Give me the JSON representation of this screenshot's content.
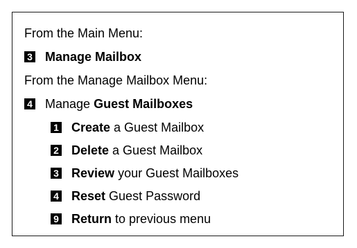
{
  "main_menu": {
    "intro": "From the Main Menu:",
    "key": "3",
    "label": "Manage Mailbox"
  },
  "mailbox_menu": {
    "intro": "From the Manage Mailbox Menu:",
    "key": "4",
    "label_plain": "Manage ",
    "label_bold": "Guest Mailboxes"
  },
  "guest_options": [
    {
      "key": "1",
      "action": "Create",
      "rest": " a Guest Mailbox"
    },
    {
      "key": "2",
      "action": "Delete",
      "rest": " a Guest Mailbox"
    },
    {
      "key": "3",
      "action": "Review",
      "rest": " your Guest Mailboxes"
    },
    {
      "key": "4",
      "action": "Reset",
      "rest": " Guest Password"
    },
    {
      "key": "9",
      "action": "Return",
      "rest": " to previous menu"
    }
  ]
}
